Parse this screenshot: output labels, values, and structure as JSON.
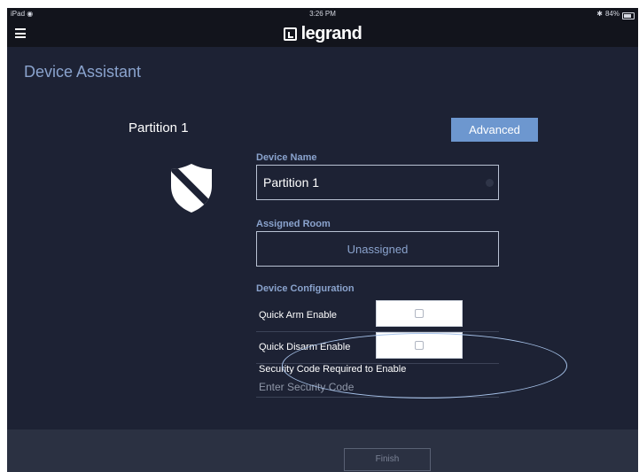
{
  "status_bar": {
    "device": "iPad",
    "time": "3:26 PM",
    "battery": "84%"
  },
  "header": {
    "brand": "legrand"
  },
  "page": {
    "title": "Device Assistant",
    "partition_name": "Partition 1"
  },
  "advanced_button": {
    "label": "Advanced"
  },
  "device_name": {
    "label": "Device Name",
    "value": "Partition 1"
  },
  "assigned_room": {
    "label": "Assigned Room",
    "value": "Unassigned"
  },
  "device_configuration": {
    "label": "Device Configuration",
    "rows": [
      {
        "label": "Quick Arm Enable",
        "checked": false
      },
      {
        "label": "Quick Disarm Enable",
        "checked": false
      }
    ],
    "security_code_label": "Security Code Required to Enable",
    "security_code_placeholder": "Enter Security Code"
  },
  "footer": {
    "finish_label": "Finish"
  },
  "colors": {
    "background": "#1d2234",
    "accent": "#6d97cf",
    "label": "#8aa3cd",
    "topbar": "#12141c"
  }
}
